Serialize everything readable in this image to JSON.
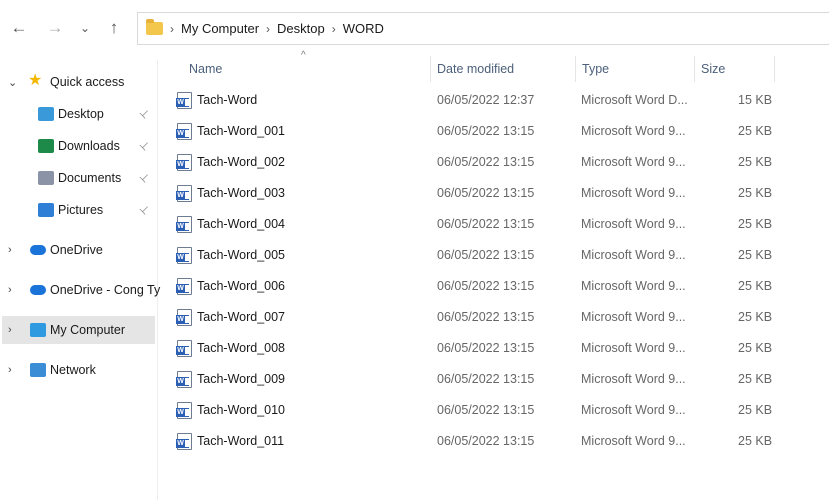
{
  "nav": {
    "back": "←",
    "forward": "→",
    "recent": "⌄",
    "up": "↑"
  },
  "breadcrumb": [
    "My Computer",
    "Desktop",
    "WORD"
  ],
  "sidebar": {
    "items": [
      {
        "label": "Quick access",
        "icon": "star-icon"
      },
      {
        "label": "Desktop",
        "icon": "desktop-icon",
        "pinned": true
      },
      {
        "label": "Downloads",
        "icon": "download-icon",
        "pinned": true
      },
      {
        "label": "Documents",
        "icon": "documents-icon",
        "pinned": true
      },
      {
        "label": "Pictures",
        "icon": "pictures-icon",
        "pinned": true
      },
      {
        "label": "OneDrive",
        "icon": "cloud-icon"
      },
      {
        "label": "OneDrive - Cong Ty",
        "icon": "cloud-icon"
      },
      {
        "label": "My Computer",
        "icon": "computer-icon",
        "selected": true
      },
      {
        "label": "Network",
        "icon": "network-icon"
      }
    ]
  },
  "columns": {
    "name": "Name",
    "date": "Date modified",
    "type": "Type",
    "size": "Size"
  },
  "files": [
    {
      "name": "Tach-Word",
      "date": "06/05/2022 12:37",
      "type": "Microsoft Word D...",
      "size": "15 KB"
    },
    {
      "name": "Tach-Word_001",
      "date": "06/05/2022 13:15",
      "type": "Microsoft Word 9...",
      "size": "25 KB"
    },
    {
      "name": "Tach-Word_002",
      "date": "06/05/2022 13:15",
      "type": "Microsoft Word 9...",
      "size": "25 KB"
    },
    {
      "name": "Tach-Word_003",
      "date": "06/05/2022 13:15",
      "type": "Microsoft Word 9...",
      "size": "25 KB"
    },
    {
      "name": "Tach-Word_004",
      "date": "06/05/2022 13:15",
      "type": "Microsoft Word 9...",
      "size": "25 KB"
    },
    {
      "name": "Tach-Word_005",
      "date": "06/05/2022 13:15",
      "type": "Microsoft Word 9...",
      "size": "25 KB"
    },
    {
      "name": "Tach-Word_006",
      "date": "06/05/2022 13:15",
      "type": "Microsoft Word 9...",
      "size": "25 KB"
    },
    {
      "name": "Tach-Word_007",
      "date": "06/05/2022 13:15",
      "type": "Microsoft Word 9...",
      "size": "25 KB"
    },
    {
      "name": "Tach-Word_008",
      "date": "06/05/2022 13:15",
      "type": "Microsoft Word 9...",
      "size": "25 KB"
    },
    {
      "name": "Tach-Word_009",
      "date": "06/05/2022 13:15",
      "type": "Microsoft Word 9...",
      "size": "25 KB"
    },
    {
      "name": "Tach-Word_010",
      "date": "06/05/2022 13:15",
      "type": "Microsoft Word 9...",
      "size": "25 KB"
    },
    {
      "name": "Tach-Word_011",
      "date": "06/05/2022 13:15",
      "type": "Microsoft Word 9...",
      "size": "25 KB"
    }
  ]
}
